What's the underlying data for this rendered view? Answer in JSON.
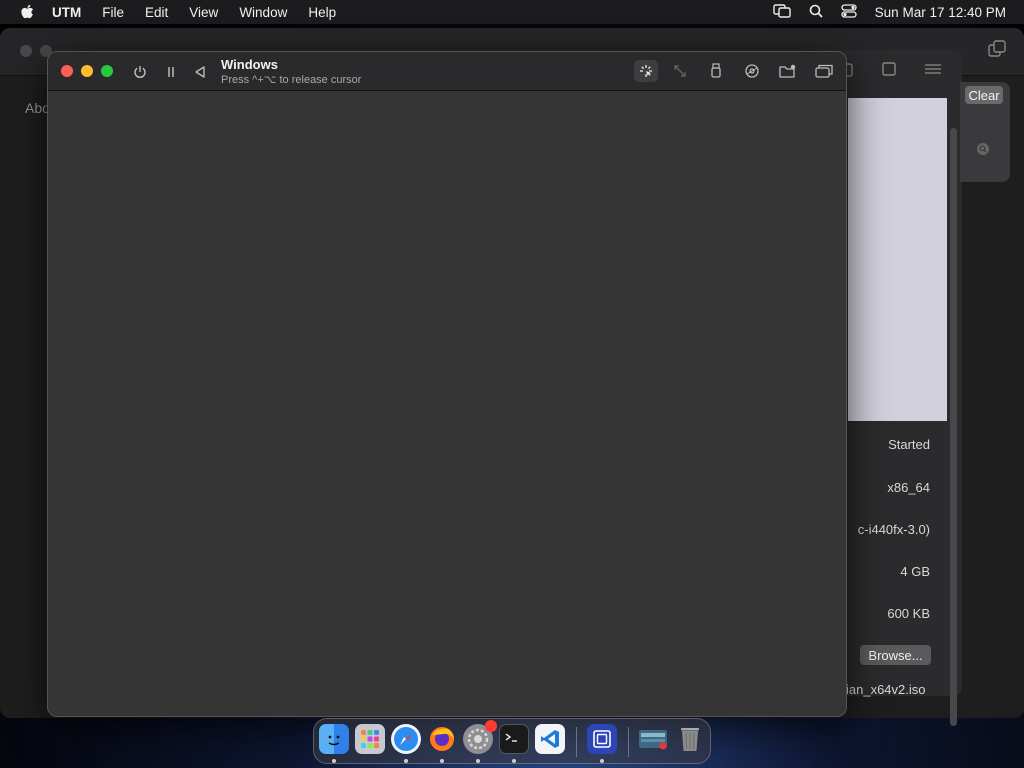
{
  "menubar": {
    "app_name": "UTM",
    "items": [
      "File",
      "Edit",
      "View",
      "Window",
      "Help"
    ],
    "clock": "Sun Mar 17  12:40 PM",
    "icons": [
      "apple-icon",
      "screen-mirror-icon",
      "spotlight-search-icon",
      "control-center-icon"
    ]
  },
  "main_window": {
    "sidebar_partial_text": "Abo"
  },
  "details": {
    "status": "Started",
    "architecture": "x86_64",
    "machine": "c-i440fx-3.0)",
    "memory": "4 GB",
    "size": "600 KB",
    "browse_label": "Browse...",
    "iso_name": "ian_x64v2.iso",
    "clear_label": "Clear"
  },
  "vm_window": {
    "title": "Windows",
    "subtitle": "Press ^+⌥ to release cursor",
    "toolbar_icons": [
      "capture-mouse-icon",
      "resize-icon",
      "usb-icon",
      "drive-icon",
      "shared-folder-icon",
      "windows-icon"
    ]
  },
  "dock": {
    "apps": [
      "Finder",
      "Launchpad",
      "Safari",
      "Firefox",
      "System Settings",
      "Terminal",
      "Visual Studio Code",
      "UTM",
      "Preview",
      "Trash"
    ],
    "settings_badge": "1"
  },
  "colors": {
    "close": "#ff5f57",
    "minimize": "#febc2e",
    "maximize": "#28c840",
    "vm_background": "#353535"
  }
}
